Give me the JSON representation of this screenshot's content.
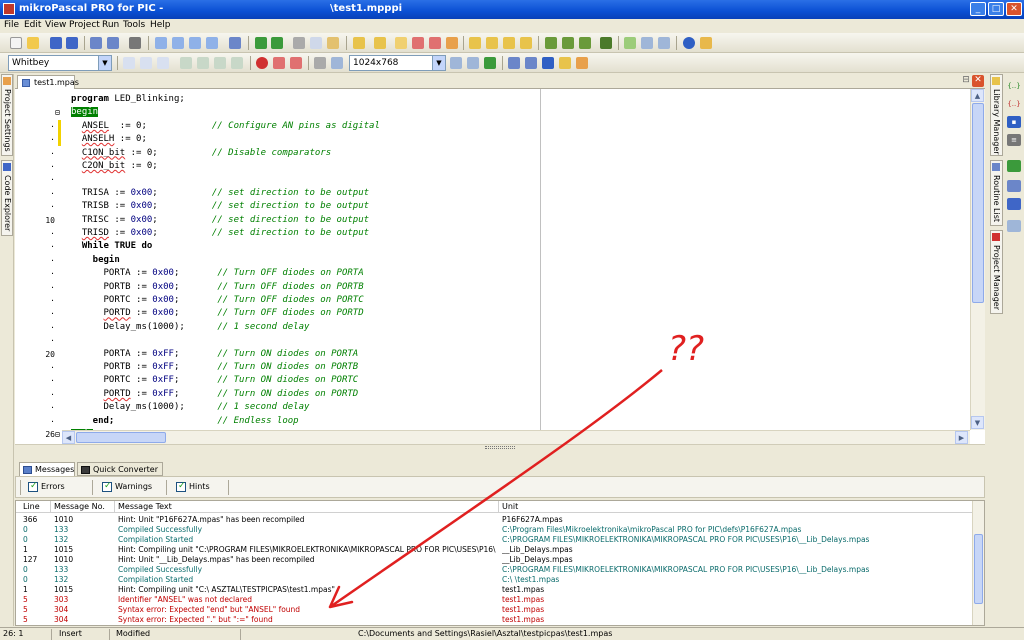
{
  "window": {
    "app_name": "mikroPascal PRO for PIC -",
    "document_title": "\\test1.mpppi",
    "minimize": "_",
    "maximize": "□",
    "close": "✕"
  },
  "menu": [
    "File",
    "Edit",
    "View",
    "Project",
    "Run",
    "Tools",
    "Help"
  ],
  "toolbar": {
    "scheme_combo": "Whitbey",
    "resolution_combo": "1024x768"
  },
  "left_panel_tabs": [
    "Project Settings",
    "Code Explorer"
  ],
  "right_panel_tabs": [
    "Library Manager",
    "Routine List",
    "Project Manager"
  ],
  "editor": {
    "tab_label": "test1.mpas",
    "lines": [
      {
        "num": "",
        "marker": "none",
        "code": [
          {
            "t": "program ",
            "c": "kw"
          },
          {
            "t": "LED_Blinking;",
            "c": ""
          }
        ]
      },
      {
        "num": "",
        "marker": "fold",
        "code": [
          {
            "t": "begin",
            "c": "hl-green"
          }
        ]
      },
      {
        "num": "·",
        "marker": "yellow",
        "code": [
          {
            "t": "  ",
            "c": ""
          },
          {
            "t": "ANSEL",
            "c": "wavy"
          },
          {
            "t": "  := 0;            ",
            "c": ""
          },
          {
            "t": "// Configure AN pins as digital",
            "c": "cm"
          }
        ]
      },
      {
        "num": "·",
        "marker": "yellow",
        "code": [
          {
            "t": "  ",
            "c": ""
          },
          {
            "t": "ANSELH",
            "c": "wavy"
          },
          {
            "t": " := 0;",
            "c": ""
          }
        ]
      },
      {
        "num": "·",
        "marker": "none",
        "code": [
          {
            "t": "  ",
            "c": ""
          },
          {
            "t": "C1ON_bit",
            "c": "wavy"
          },
          {
            "t": " := 0;          ",
            "c": ""
          },
          {
            "t": "// Disable comparators",
            "c": "cm"
          }
        ]
      },
      {
        "num": "·",
        "marker": "none",
        "code": [
          {
            "t": "  ",
            "c": ""
          },
          {
            "t": "C2ON_bit",
            "c": "wavy"
          },
          {
            "t": " := 0;",
            "c": ""
          }
        ]
      },
      {
        "num": "·",
        "marker": "none",
        "code": []
      },
      {
        "num": "·",
        "marker": "none",
        "code": [
          {
            "t": "  TRISA := ",
            "c": ""
          },
          {
            "t": "0x00",
            "c": "hx"
          },
          {
            "t": ";          ",
            "c": ""
          },
          {
            "t": "// set direction to be output",
            "c": "cm"
          }
        ]
      },
      {
        "num": "·",
        "marker": "none",
        "code": [
          {
            "t": "  TRISB := ",
            "c": ""
          },
          {
            "t": "0x00",
            "c": "hx"
          },
          {
            "t": ";          ",
            "c": ""
          },
          {
            "t": "// set direction to be output",
            "c": "cm"
          }
        ]
      },
      {
        "num": "10",
        "marker": "none",
        "code": [
          {
            "t": "  TRISC := ",
            "c": ""
          },
          {
            "t": "0x00",
            "c": "hx"
          },
          {
            "t": ";          ",
            "c": ""
          },
          {
            "t": "// set direction to be output",
            "c": "cm"
          }
        ]
      },
      {
        "num": "·",
        "marker": "none",
        "code": [
          {
            "t": "  ",
            "c": ""
          },
          {
            "t": "TRISD",
            "c": "wavy"
          },
          {
            "t": " := ",
            "c": ""
          },
          {
            "t": "0x00",
            "c": "hx"
          },
          {
            "t": ";          ",
            "c": ""
          },
          {
            "t": "// set direction to be output",
            "c": "cm"
          }
        ]
      },
      {
        "num": "·",
        "marker": "none",
        "code": [
          {
            "t": "  While TRUE do",
            "c": "kw"
          }
        ]
      },
      {
        "num": "·",
        "marker": "none",
        "code": [
          {
            "t": "    begin",
            "c": "kw"
          }
        ]
      },
      {
        "num": "·",
        "marker": "none",
        "code": [
          {
            "t": "      PORTA := ",
            "c": ""
          },
          {
            "t": "0x00",
            "c": "hx"
          },
          {
            "t": ";       ",
            "c": ""
          },
          {
            "t": "// Turn OFF diodes on PORTA",
            "c": "cm"
          }
        ]
      },
      {
        "num": "·",
        "marker": "none",
        "code": [
          {
            "t": "      PORTB := ",
            "c": ""
          },
          {
            "t": "0x00",
            "c": "hx"
          },
          {
            "t": ";       ",
            "c": ""
          },
          {
            "t": "// Turn OFF diodes on PORTB",
            "c": "cm"
          }
        ]
      },
      {
        "num": "·",
        "marker": "none",
        "code": [
          {
            "t": "      PORTC := ",
            "c": ""
          },
          {
            "t": "0x00",
            "c": "hx"
          },
          {
            "t": ";       ",
            "c": ""
          },
          {
            "t": "// Turn OFF diodes on PORTC",
            "c": "cm"
          }
        ]
      },
      {
        "num": "·",
        "marker": "none",
        "code": [
          {
            "t": "      ",
            "c": ""
          },
          {
            "t": "PORTD",
            "c": "wavy"
          },
          {
            "t": " := ",
            "c": ""
          },
          {
            "t": "0x00",
            "c": "hx"
          },
          {
            "t": ";       ",
            "c": ""
          },
          {
            "t": "// Turn OFF diodes on PORTD",
            "c": "cm"
          }
        ]
      },
      {
        "num": "·",
        "marker": "none",
        "code": [
          {
            "t": "      Delay_ms(1000);      ",
            "c": ""
          },
          {
            "t": "// 1 second delay",
            "c": "cm"
          }
        ]
      },
      {
        "num": "·",
        "marker": "none",
        "code": []
      },
      {
        "num": "20",
        "marker": "none",
        "code": [
          {
            "t": "      PORTA := ",
            "c": ""
          },
          {
            "t": "0xFF",
            "c": "hx"
          },
          {
            "t": ";       ",
            "c": ""
          },
          {
            "t": "// Turn ON diodes on PORTA",
            "c": "cm"
          }
        ]
      },
      {
        "num": "·",
        "marker": "none",
        "code": [
          {
            "t": "      PORTB := ",
            "c": ""
          },
          {
            "t": "0xFF",
            "c": "hx"
          },
          {
            "t": ";       ",
            "c": ""
          },
          {
            "t": "// Turn ON diodes on PORTB",
            "c": "cm"
          }
        ]
      },
      {
        "num": "·",
        "marker": "none",
        "code": [
          {
            "t": "      PORTC := ",
            "c": ""
          },
          {
            "t": "0xFF",
            "c": "hx"
          },
          {
            "t": ";       ",
            "c": ""
          },
          {
            "t": "// Turn ON diodes on PORTC",
            "c": "cm"
          }
        ]
      },
      {
        "num": "·",
        "marker": "none",
        "code": [
          {
            "t": "      ",
            "c": ""
          },
          {
            "t": "PORTD",
            "c": "wavy"
          },
          {
            "t": " := ",
            "c": ""
          },
          {
            "t": "0xFF",
            "c": "hx"
          },
          {
            "t": ";       ",
            "c": ""
          },
          {
            "t": "// Turn ON diodes on PORTD",
            "c": "cm"
          }
        ]
      },
      {
        "num": "·",
        "marker": "none",
        "code": [
          {
            "t": "      Delay_ms(1000);      ",
            "c": ""
          },
          {
            "t": "// 1 second delay",
            "c": "cm"
          }
        ]
      },
      {
        "num": "·",
        "marker": "none",
        "code": [
          {
            "t": "    end;",
            "c": "kw"
          },
          {
            "t": "                   ",
            "c": ""
          },
          {
            "t": "// Endless loop",
            "c": "cm"
          }
        ]
      },
      {
        "num": "26",
        "marker": "fold",
        "code": [
          {
            "t": "end.",
            "c": "hl-green"
          }
        ]
      }
    ]
  },
  "messages": {
    "tabs": [
      "Messages",
      "Quick Converter"
    ],
    "filters": [
      "Errors",
      "Warnings",
      "Hints"
    ],
    "columns": [
      "Line",
      "Message No.",
      "Message Text",
      "Unit"
    ],
    "rows": [
      {
        "line": "366",
        "no": "1010",
        "text": "Hint: Unit \"P16F627A.mpas\" has been recompiled",
        "unit": "P16F627A.mpas",
        "type": "hint"
      },
      {
        "line": "0",
        "no": "133",
        "text": "Compiled Successfully",
        "unit": "C:\\Program Files\\Mikroelektronika\\mikroPascal PRO for PIC\\defs\\P16F627A.mpas",
        "type": "info"
      },
      {
        "line": "0",
        "no": "132",
        "text": "Compilation Started",
        "unit": "C:\\PROGRAM FILES\\MIKROELEKTRONIKA\\MIKROPASCAL PRO FOR PIC\\USES\\P16\\__Lib_Delays.mpas",
        "type": "info"
      },
      {
        "line": "1",
        "no": "1015",
        "text": "Hint: Compiling unit \"C:\\PROGRAM FILES\\MIKROELEKTRONIKA\\MIKROPASCAL PRO FOR PIC\\USES\\P16\\...",
        "unit": "__Lib_Delays.mpas",
        "type": "hint"
      },
      {
        "line": "127",
        "no": "1010",
        "text": "Hint: Unit \"__Lib_Delays.mpas\" has been recompiled",
        "unit": "__Lib_Delays.mpas",
        "type": "hint"
      },
      {
        "line": "0",
        "no": "133",
        "text": "Compiled Successfully",
        "unit": "C:\\PROGRAM FILES\\MIKROELEKTRONIKA\\MIKROPASCAL PRO FOR PIC\\USES\\P16\\__Lib_Delays.mpas",
        "type": "info"
      },
      {
        "line": "0",
        "no": "132",
        "text": "Compilation Started",
        "unit": "C:\\                                                                \\test1.mpas",
        "type": "info"
      },
      {
        "line": "1",
        "no": "1015",
        "text": "Hint: Compiling unit \"C:\\                                  ASZTAL\\TESTPICPAS\\test1.mpas\"",
        "unit": "test1.mpas",
        "type": "hint"
      },
      {
        "line": "5",
        "no": "303",
        "text": "Identifier \"ANSEL\" was not declared",
        "unit": "test1.mpas",
        "type": "error"
      },
      {
        "line": "5",
        "no": "304",
        "text": "Syntax error: Expected \"end\" but \"ANSEL\" found",
        "unit": "test1.mpas",
        "type": "error"
      },
      {
        "line": "5",
        "no": "304",
        "text": "Syntax error: Expected \".\" but \":=\" found",
        "unit": "test1.mpas",
        "type": "error"
      }
    ]
  },
  "annotation": {
    "text": "??",
    "color": "#e02020"
  },
  "status": {
    "position": "26: 1",
    "mode": "Insert",
    "modified": "Modified",
    "path": "C:\\Documents and Settings\\Rasiel\\Asztal\\testpicpas\\test1.mpas"
  }
}
